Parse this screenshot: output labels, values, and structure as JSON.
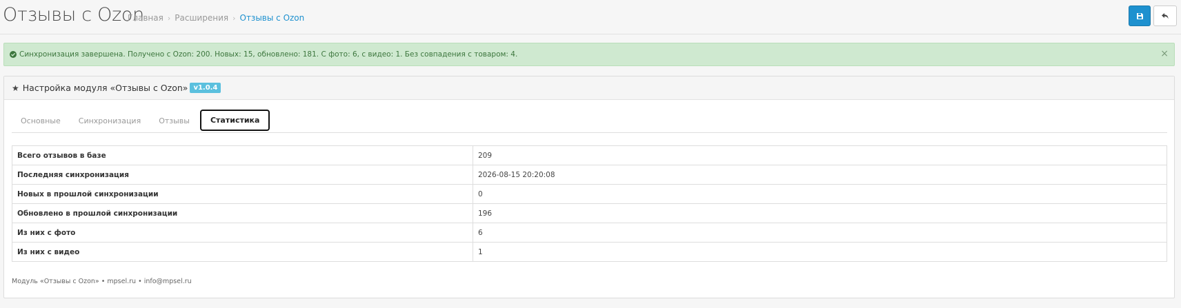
{
  "header": {
    "title": "Отзывы с Ozon",
    "breadcrumb": [
      {
        "label": "Главная"
      },
      {
        "label": "Расширения"
      },
      {
        "label": "Отзывы с Ozon"
      }
    ],
    "icons": {
      "save": "save-icon",
      "back": "reply-icon"
    },
    "accent_color": "#1e91cf"
  },
  "alert": {
    "message": "Синхронизация завершена. Получено с Ozon: 200. Новых: 15, обновлено: 181. С фото: 6, с видео: 1. Без совпадения с товаром: 4.",
    "close": "×",
    "color": "#3c763d"
  },
  "panel": {
    "title": "Настройка модуля «Отзывы с Ozon»",
    "version": "v1.0.4",
    "tabs": [
      {
        "label": "Основные"
      },
      {
        "label": "Синхронизация"
      },
      {
        "label": "Отзывы"
      },
      {
        "label": "Статистика",
        "active": true
      }
    ],
    "stats": [
      {
        "label": "Всего отзывов в базе",
        "value": "209"
      },
      {
        "label": "Последняя синхронизация",
        "value": "2026-08-15 20:20:08"
      },
      {
        "label": "Новых в прошлой синхронизации",
        "value": "0"
      },
      {
        "label": "Обновлено в прошлой синхронизации",
        "value": "196"
      },
      {
        "label": "Из них с фото",
        "value": "6"
      },
      {
        "label": "Из них с видео",
        "value": "1"
      }
    ],
    "footer": "Модуль «Отзывы с Ozon» • mpsel.ru • info@mpsel.ru"
  }
}
